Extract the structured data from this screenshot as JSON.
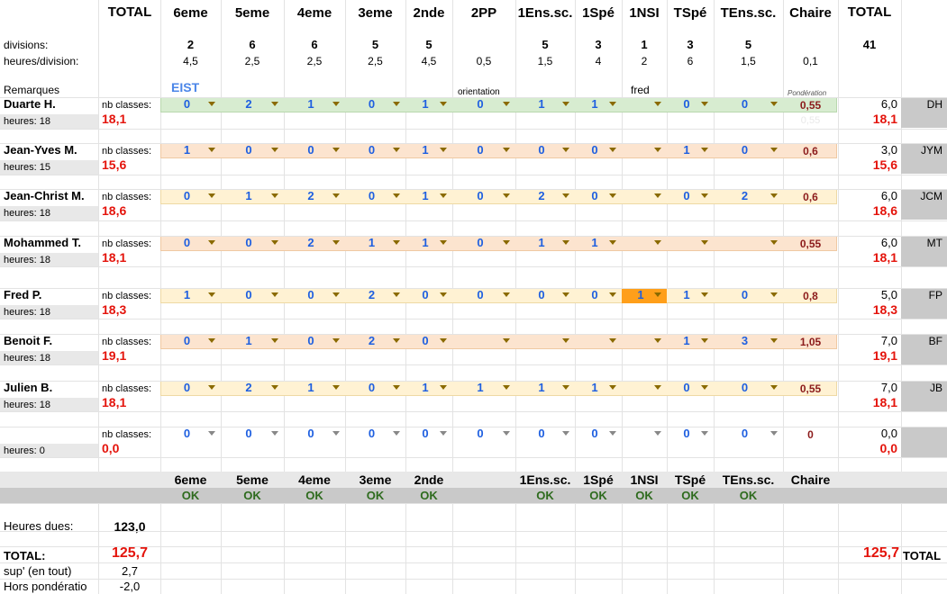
{
  "columns": [
    "6eme",
    "5eme",
    "4eme",
    "3eme",
    "2nde",
    "2PP",
    "1Ens.sc.",
    "1Spé",
    "1NSI",
    "TSpé",
    "TEns.sc.",
    "Chaire"
  ],
  "header": {
    "total_left": "TOTAL",
    "total_right": "TOTAL"
  },
  "labels": {
    "divisions": "divisions:",
    "heures_div": "heures/division:",
    "remarques": "Remarques",
    "nb_classes": "nb classes:",
    "heures_dues": "Heures dues:",
    "total": "TOTAL:",
    "sup": "sup' (en tout)",
    "hors": "Hors pondératio"
  },
  "divisions": [
    "2",
    "6",
    "6",
    "5",
    "5",
    "",
    "5",
    "3",
    "1",
    "3",
    "5",
    ""
  ],
  "divisions_total": "41",
  "heures_division": [
    "4,5",
    "2,5",
    "2,5",
    "2,5",
    "4,5",
    "0,5",
    "1,5",
    "4",
    "2",
    "6",
    "1,5",
    "0,1"
  ],
  "remarks": {
    "eist": "EIST",
    "orientation": "orientation",
    "fred": "fred",
    "ponderation": "Pondération"
  },
  "teachers": [
    {
      "name": "Duarte H.",
      "heures": "heures: 18",
      "total": "18,1",
      "values": [
        "0",
        "2",
        "1",
        "0",
        "1",
        "0",
        "1",
        "1",
        "",
        "0",
        "0"
      ],
      "pond": "0,55",
      "pond2": "0,55",
      "sum": "6,0",
      "sum2": "18,1",
      "code": "DH",
      "band": "green"
    },
    {
      "name": "Jean-Yves M.",
      "heures": "heures: 15",
      "total": "15,6",
      "values": [
        "1",
        "0",
        "0",
        "0",
        "1",
        "0",
        "0",
        "0",
        "",
        "1",
        "0"
      ],
      "pond": "0,6",
      "pond2": "",
      "sum": "3,0",
      "sum2": "15,6",
      "code": "JYM",
      "band": "peach"
    },
    {
      "name": "Jean-Christ M.",
      "heures": "heures: 18",
      "total": "18,6",
      "values": [
        "0",
        "1",
        "2",
        "0",
        "1",
        "0",
        "2",
        "0",
        "",
        "0",
        "2"
      ],
      "pond": "0,6",
      "pond2": "",
      "sum": "6,0",
      "sum2": "18,6",
      "code": "JCM",
      "band": "yellow"
    },
    {
      "name": "Mohammed T.",
      "heures": "heures: 18",
      "total": "18,1",
      "values": [
        "0",
        "0",
        "2",
        "1",
        "1",
        "0",
        "1",
        "1",
        "",
        "",
        ""
      ],
      "pond": "0,55",
      "pond2": "",
      "sum": "6,0",
      "sum2": "18,1",
      "code": "MT",
      "band": "peach"
    },
    {
      "name": "Fred P.",
      "heures": "heures: 18",
      "total": "18,3",
      "values": [
        "1",
        "0",
        "0",
        "2",
        "0",
        "0",
        "0",
        "0",
        "1",
        "1",
        "0"
      ],
      "pond": "0,8",
      "pond2": "",
      "sum": "5,0",
      "sum2": "18,3",
      "code": "FP",
      "band": "yellow"
    },
    {
      "name": "Benoit F.",
      "heures": "heures: 18",
      "total": "19,1",
      "values": [
        "0",
        "1",
        "0",
        "2",
        "0",
        "",
        "",
        "",
        "",
        "1",
        "3"
      ],
      "pond": "1,05",
      "pond2": "",
      "sum": "7,0",
      "sum2": "19,1",
      "code": "BF",
      "band": "peach"
    },
    {
      "name": "Julien B.",
      "heures": "heures: 18",
      "total": "18,1",
      "values": [
        "0",
        "2",
        "1",
        "0",
        "1",
        "1",
        "1",
        "1",
        "",
        "0",
        "0"
      ],
      "pond": "0,55",
      "pond2": "",
      "sum": "7,0",
      "sum2": "18,1",
      "code": "JB",
      "band": "yellow"
    },
    {
      "name": "",
      "heures": "heures: 0",
      "total": "0,0",
      "values": [
        "0",
        "0",
        "0",
        "0",
        "0",
        "0",
        "0",
        "0",
        "",
        "0",
        "0"
      ],
      "pond": "0",
      "pond2": "",
      "sum": "0,0",
      "sum2": "0,0",
      "code": "",
      "band": "none"
    }
  ],
  "bottom_cols": [
    "6eme",
    "5eme",
    "4eme",
    "3eme",
    "2nde",
    "",
    "1Ens.sc.",
    "1Spé",
    "1NSI",
    "TSpé",
    "TEns.sc.",
    "Chaire"
  ],
  "ok_values": [
    "OK",
    "OK",
    "OK",
    "OK",
    "OK",
    "",
    "OK",
    "OK",
    "OK",
    "OK",
    "OK",
    ""
  ],
  "heures_dues": "123,0",
  "total_value": "125,7",
  "total_right_value": "125,7",
  "sup_value": "2,7",
  "hors_value": "-2,0",
  "colors": {
    "green": "#d7ecd0",
    "peach": "#fce4cf",
    "yellow": "#fff2d3",
    "red": "#e4140c",
    "blue": "#1e5fe0",
    "orange": "#ff9f1a"
  }
}
